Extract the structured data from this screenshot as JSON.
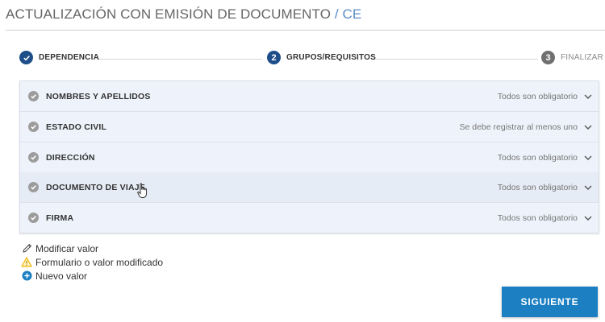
{
  "header": {
    "title": "ACTUALIZACIÓN CON EMISIÓN DE DOCUMENTO",
    "separator": " / ",
    "code": "CE"
  },
  "stepper": {
    "steps": [
      {
        "number": "1",
        "label": "DEPENDENCIA",
        "state": "done"
      },
      {
        "number": "2",
        "label": "GRUPOS/REQUISITOS",
        "state": "active"
      },
      {
        "number": "3",
        "label": "FINALIZAR",
        "state": "pending"
      }
    ]
  },
  "groups": [
    {
      "name": "NOMBRES Y APELLIDOS",
      "status": "Todos son obligatorio"
    },
    {
      "name": "ESTADO CIVIL",
      "status": "Se debe registrar al menos uno"
    },
    {
      "name": "DIRECCIÓN",
      "status": "Todos son obligatorio"
    },
    {
      "name": "DOCUMENTO DE VIAJE",
      "status": "Todos son obligatorio"
    },
    {
      "name": "FIRMA",
      "status": "Todos son obligatorio"
    }
  ],
  "legend": {
    "modify": "Modificar valor",
    "modified": "Formulario o valor modificado",
    "new": "Nuevo valor"
  },
  "actions": {
    "next": "SIGUIENTE"
  },
  "colors": {
    "primary": "#1d4e89",
    "button": "#1b7fc2",
    "warning": "#f0b400",
    "info": "#1b7fc2"
  }
}
